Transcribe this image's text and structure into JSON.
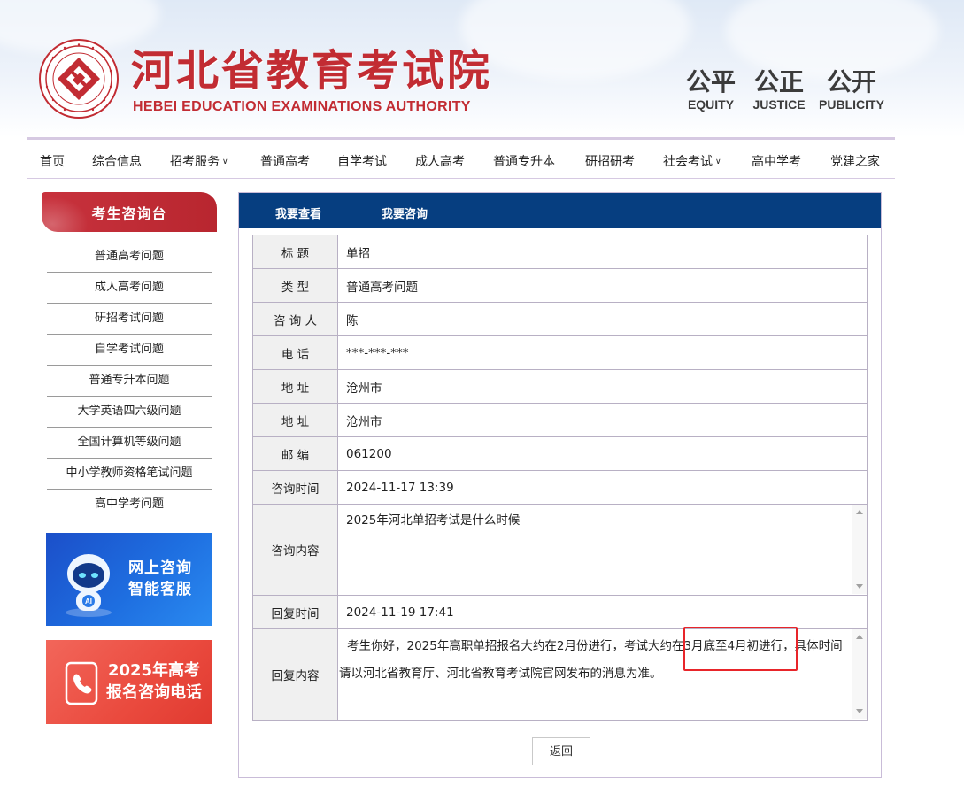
{
  "header": {
    "title": "河北省教育考试院",
    "subtitle": "HEBEI EDUCATION EXAMINATIONS AUTHORITY",
    "mottos": [
      {
        "cn": "公平",
        "en": "EQUITY"
      },
      {
        "cn": "公正",
        "en": "JUSTICE"
      },
      {
        "cn": "公开",
        "en": "PUBLICITY"
      }
    ]
  },
  "nav": {
    "items": [
      {
        "label": "首页"
      },
      {
        "label": "综合信息"
      },
      {
        "label": "招考服务",
        "dropdown": true
      },
      {
        "label": "普通高考"
      },
      {
        "label": "自学考试"
      },
      {
        "label": "成人高考"
      },
      {
        "label": "普通专升本"
      },
      {
        "label": "研招研考"
      },
      {
        "label": "社会考试",
        "dropdown": true
      },
      {
        "label": "高中学考"
      },
      {
        "label": "党建之家"
      }
    ]
  },
  "sidebar": {
    "heading": "考生咨询台",
    "items": [
      "普通高考问题",
      "成人高考问题",
      "研招考试问题",
      "自学考试问题",
      "普通专升本问题",
      "大学英语四六级问题",
      "全国计算机等级问题",
      "中小学教师资格笔试问题",
      "高中学考问题"
    ],
    "banner_ai": {
      "line1": "网上咨询",
      "line2": "智能客服",
      "bot_text": "AI"
    },
    "banner_phone": {
      "line1": "2025年高考",
      "line2": "报名咨询电话"
    }
  },
  "tabs": [
    "我要查看",
    "我要咨询"
  ],
  "detail": {
    "rows": [
      {
        "label": "标 题",
        "value": "单招"
      },
      {
        "label": "类 型",
        "value": "普通高考问题"
      },
      {
        "label": "咨 询 人",
        "value": "陈"
      },
      {
        "label": "电 话",
        "value": "***-***-***"
      },
      {
        "label": "地 址",
        "value": "沧州市"
      },
      {
        "label": "地 址",
        "value": "沧州市"
      },
      {
        "label": "邮 编",
        "value": "061200"
      },
      {
        "label": "咨询时间",
        "value": "2024-11-17 13:39"
      }
    ],
    "question_label": "咨询内容",
    "question_text": "2025年河北单招考试是什么时候",
    "reply_time_label": "回复时间",
    "reply_time": "2024-11-19 17:41",
    "reply_label": "回复内容",
    "reply_text": "考生你好，2025年高职单招报名大约在2月份进行，考试大约在3月底至4月初进行，具体时间请以河北省教育厅、河北省教育考试院官网发布的消息为准。"
  },
  "back_button": "返回",
  "colors": {
    "brand_red": "#c22c33",
    "tab_blue": "#063e80",
    "highlight": "#e8252a"
  }
}
